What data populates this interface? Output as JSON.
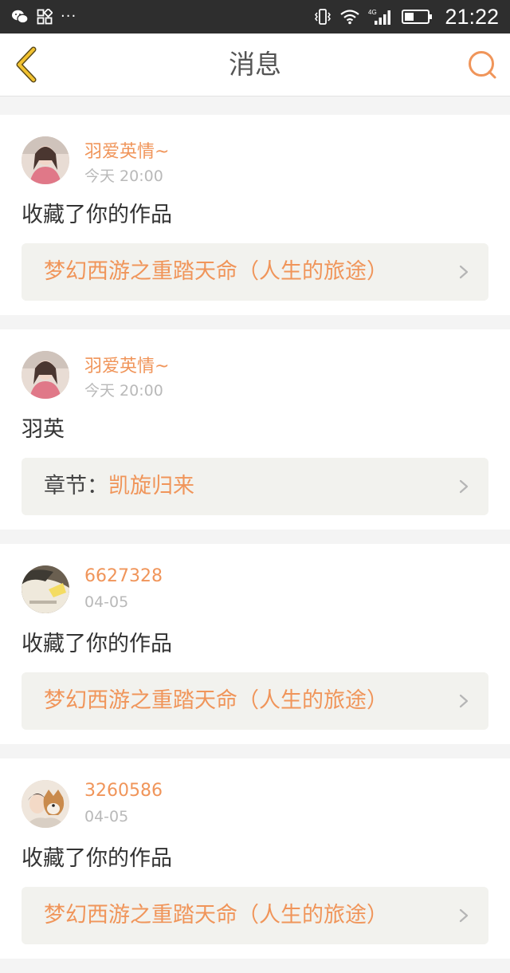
{
  "status_bar": {
    "left_icons": [
      "wechat-icon",
      "app-grid-icon",
      "more-dots-icon"
    ],
    "dots": "···",
    "right_icons": [
      "vibrate-icon",
      "wifi-icon",
      "signal-4g-icon",
      "battery-icon"
    ],
    "network_label": "4G",
    "time": "21:22"
  },
  "nav": {
    "title": "消息",
    "back_icon": "back-chevron-icon",
    "search_icon": "search-icon"
  },
  "colors": {
    "accent": "#f0955a",
    "back_icon": "#e8b72a",
    "status_bar_bg": "#2e2e2e"
  },
  "messages": [
    {
      "user": "羽爱英情~",
      "time": "今天 20:00",
      "text": "收藏了你的作品",
      "link_prefix": "",
      "link_title": "梦幻西游之重踏天命（人生的旅途）"
    },
    {
      "user": "羽爱英情~",
      "time": "今天 20:00",
      "text": "羽英",
      "link_prefix": "章节：",
      "link_title": "凯旋归来"
    },
    {
      "user": "6627328",
      "time": "04-05",
      "text": "收藏了你的作品",
      "link_prefix": "",
      "link_title": "梦幻西游之重踏天命（人生的旅途）"
    },
    {
      "user": "3260586",
      "time": "04-05",
      "text": "收藏了你的作品",
      "link_prefix": "",
      "link_title": "梦幻西游之重踏天命（人生的旅途）"
    }
  ]
}
